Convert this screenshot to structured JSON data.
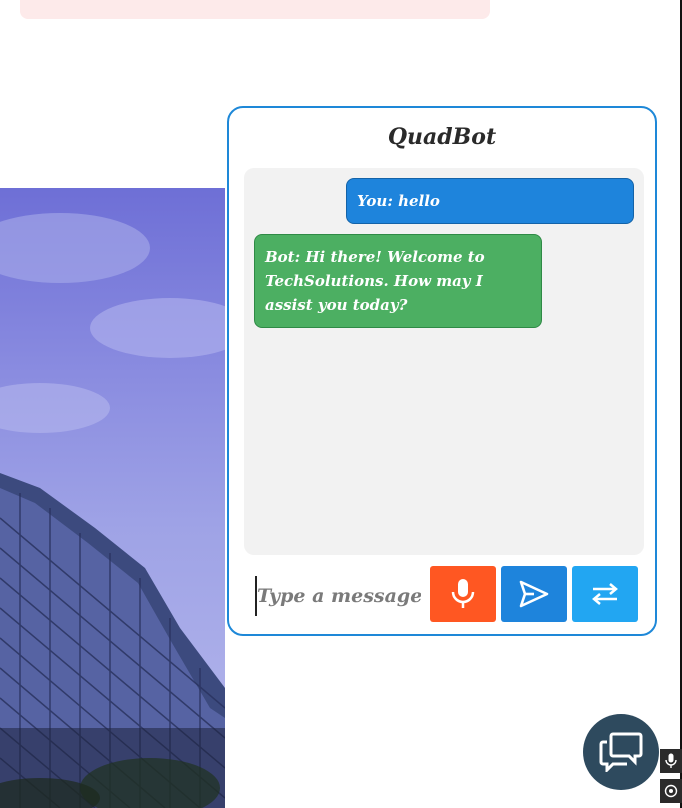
{
  "chat": {
    "title": "QuadBot",
    "messages": [
      {
        "sender": "user",
        "text": "You: hello"
      },
      {
        "sender": "bot",
        "text": "Bot: Hi there! Welcome to TechSolutions. How may I assist you today?"
      }
    ],
    "input": {
      "value": "",
      "placeholder": "Type a message..."
    },
    "buttons": {
      "mic": {
        "icon": "microphone-icon",
        "color": "#ff5722"
      },
      "send": {
        "icon": "send-icon",
        "color": "#1e84dc"
      },
      "switch": {
        "icon": "swap-arrows-icon",
        "color": "#22a6f2"
      }
    }
  },
  "fab": {
    "icon": "chat-bubbles-icon",
    "color": "#2e4a5e"
  },
  "side_tools": [
    {
      "icon": "microphone-icon"
    },
    {
      "icon": "target-icon"
    }
  ],
  "colors": {
    "accent": "#1e88d8",
    "user_bubble": "#1e84dc",
    "bot_bubble": "#4caf62"
  }
}
